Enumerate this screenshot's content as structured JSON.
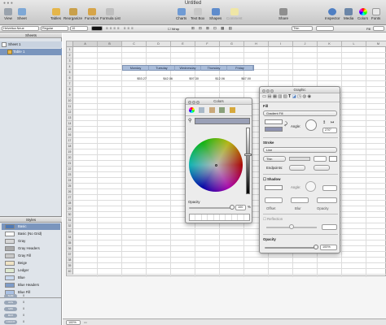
{
  "window": {
    "title": "Untitled"
  },
  "toolbar": {
    "view": "View",
    "sheet": "Sheet",
    "tables": "Tables",
    "reorganize": "Reorganize",
    "function": "Function",
    "formula_list": "Formula List",
    "charts": "Charts",
    "text_box": "Text Box",
    "shapes": "Shapes",
    "comment": "Comment",
    "share": "Share",
    "inspector": "Inspector",
    "media": "Media",
    "colors": "Colors",
    "fonts": "Fonts"
  },
  "format_bar": {
    "font": "Helvetica Neue",
    "style": "Regular",
    "size": "10",
    "wrap": "Wrap",
    "stroke": "Thin",
    "fill": "Fill"
  },
  "sidebar": {
    "sheets_header": "Sheets",
    "sheets": [
      {
        "label": "Sheet 1"
      },
      {
        "label": "Table 1"
      }
    ],
    "styles_header": "Styles",
    "styles": [
      {
        "label": "Basic",
        "color": "#4e79b6"
      },
      {
        "label": "Basic (No Grid)",
        "color": "#ffffff"
      },
      {
        "label": "Gray",
        "color": "#d6d6d6"
      },
      {
        "label": "Gray Headers",
        "color": "#a9a9a9"
      },
      {
        "label": "Gray Fill",
        "color": "#c8c8c8"
      },
      {
        "label": "Beige",
        "color": "#efe3c4"
      },
      {
        "label": "Ledger",
        "color": "#dde9cf"
      },
      {
        "label": "Blue",
        "color": "#c8d8ee"
      },
      {
        "label": "Blue Headers",
        "color": "#7e9cc9"
      },
      {
        "label": "Blue Fill",
        "color": "#a9c1e4"
      }
    ],
    "summary": [
      {
        "label": "SUM",
        "value": "0"
      },
      {
        "label": "AVG",
        "value": "0"
      },
      {
        "label": "MIN",
        "value": "0"
      },
      {
        "label": "MAX",
        "value": "0"
      },
      {
        "label": "COUNT",
        "value": "0"
      }
    ]
  },
  "sheet": {
    "columns": [
      "A",
      "B",
      "C",
      "D",
      "E",
      "F",
      "G",
      "H",
      "I",
      "J",
      "K",
      "L",
      "M",
      "N"
    ],
    "rows": [
      "1",
      "2",
      "3",
      "4",
      "5",
      "6",
      "7",
      "8",
      "9",
      "10",
      "11",
      "12",
      "13",
      "14",
      "15",
      "16",
      "17",
      "18",
      "19",
      "20",
      "21",
      "22",
      "23",
      "24",
      "25",
      "26",
      "27",
      "28",
      "29",
      "30",
      "31",
      "32",
      "33",
      "34",
      "35",
      "36",
      "37",
      "38",
      "39",
      "40",
      "41"
    ],
    "table_headers": [
      "Monday",
      "Tuesday",
      "Wednesday",
      "Thursday",
      "Friday"
    ],
    "table_values": [
      "$53.27",
      "$42.06",
      "$97.30",
      "$12.06",
      "$67.00"
    ]
  },
  "colors_panel": {
    "title": "Colors",
    "opacity_label": "Opacity",
    "opacity_value": "100",
    "opacity_unit": "%"
  },
  "graphic_panel": {
    "title": "Graphic",
    "fill_header": "Fill",
    "fill_type": "Gradient Fill",
    "angle_label": "Angle:",
    "angle_value": "270°",
    "stroke_header": "Stroke",
    "stroke_type": "Line",
    "stroke_weight": "Thin",
    "endpoints_label": "Endpoints:",
    "shadow_label": "Shadow",
    "shadow_angle_label": "Angle:",
    "offset_label": "Offset",
    "blur_label": "Blur",
    "shadow_opacity_label": "Opacity",
    "reflection_label": "Reflection",
    "opacity_header": "Opacity",
    "opacity_value": "100%"
  },
  "status": {
    "zoom": "100%"
  }
}
